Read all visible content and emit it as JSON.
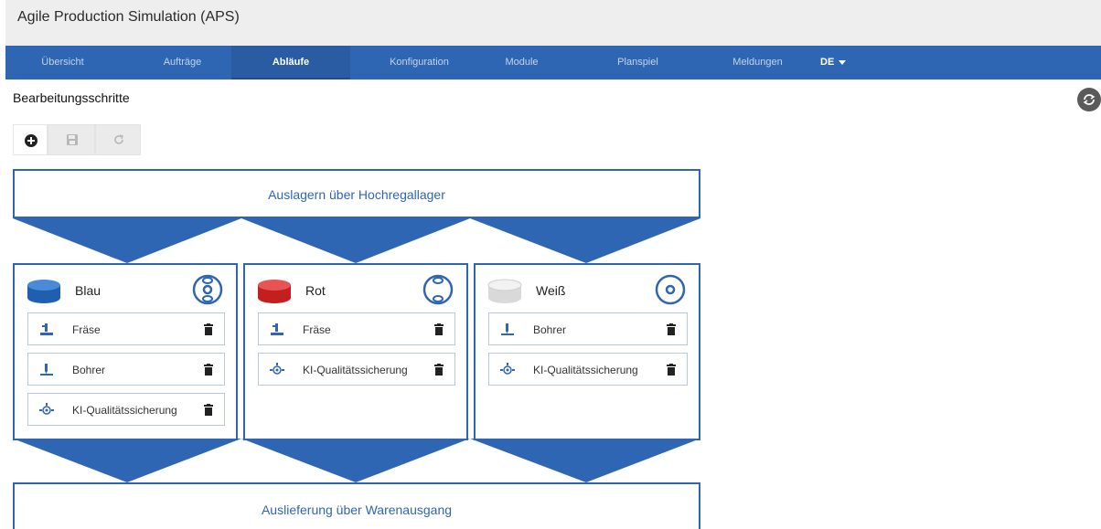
{
  "app": {
    "title": "Agile Production Simulation (APS)"
  },
  "nav": {
    "items": [
      {
        "label": "Übersicht"
      },
      {
        "label": "Aufträge"
      },
      {
        "label": "Abläufe"
      },
      {
        "label": "Konfiguration"
      },
      {
        "label": "Module"
      },
      {
        "label": "Planspiel"
      },
      {
        "label": "Meldungen"
      }
    ],
    "active": "Abläufe",
    "language": "DE"
  },
  "page": {
    "title": "Bearbeitungsschritte"
  },
  "toolbar": {
    "add_icon": "plus-circle-icon",
    "save_icon": "save-icon",
    "reload_icon": "reload-icon"
  },
  "flow": {
    "source": "Auslagern über Hochregallager",
    "sink": "Auslieferung über Warenausgang",
    "lanes": [
      {
        "name": "Blau",
        "color": "#2f66b3",
        "steps": [
          {
            "label": "Fräse",
            "icon": "mill-icon"
          },
          {
            "label": "Bohrer",
            "icon": "drill-icon"
          },
          {
            "label": "KI-Qualitätssicherung",
            "icon": "ai-camera-icon"
          }
        ]
      },
      {
        "name": "Rot",
        "color": "#d22b2b",
        "steps": [
          {
            "label": "Fräse",
            "icon": "mill-icon"
          },
          {
            "label": "KI-Qualitätssicherung",
            "icon": "ai-camera-icon"
          }
        ]
      },
      {
        "name": "Weiß",
        "color": "#e8e8e8",
        "steps": [
          {
            "label": "Bohrer",
            "icon": "drill-icon"
          },
          {
            "label": "KI-Qualitätssicherung",
            "icon": "ai-camera-icon"
          }
        ]
      }
    ]
  },
  "colors": {
    "accent": "#2f66b3",
    "nav_bg": "#2f66b3",
    "title_bg": "#eeeeee"
  }
}
